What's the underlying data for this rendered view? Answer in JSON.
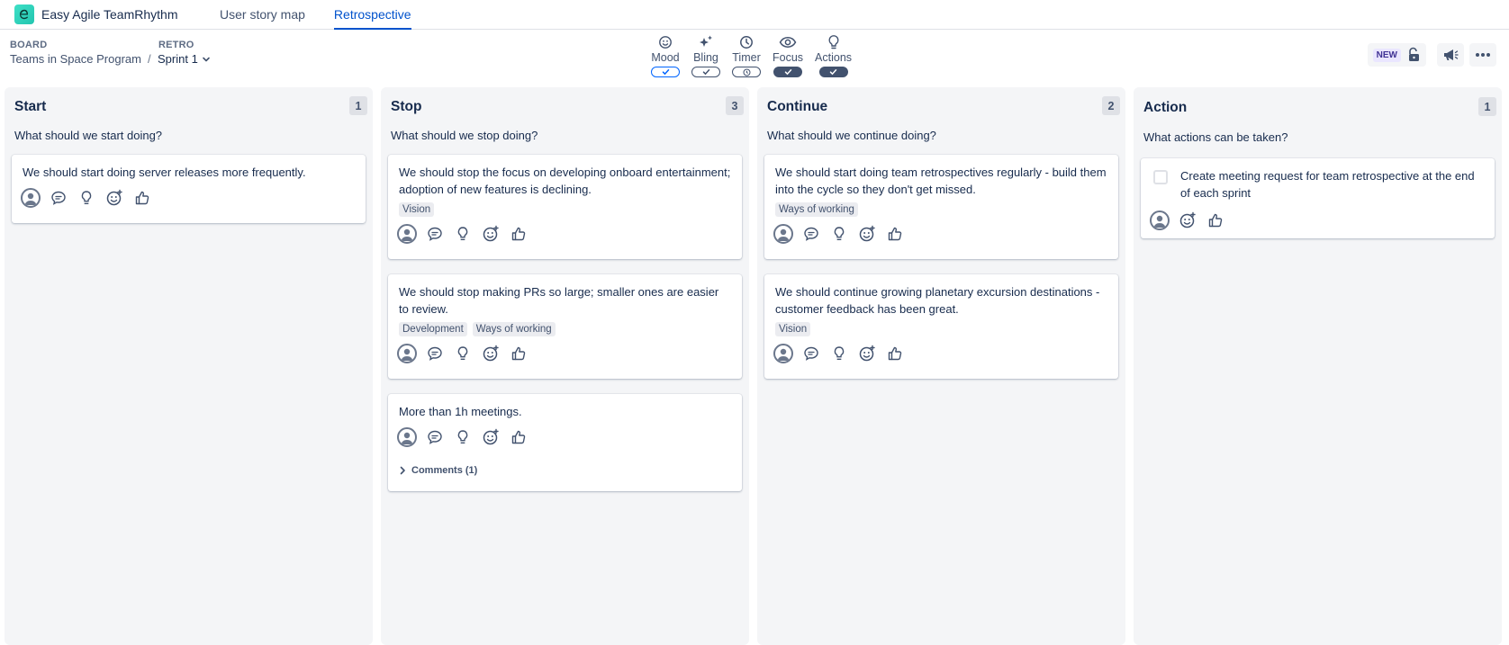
{
  "app": {
    "name": "Easy Agile TeamRhythm"
  },
  "tabs": [
    {
      "label": "User story map"
    },
    {
      "label": "Retrospective"
    }
  ],
  "breadcrumb": {
    "board_label": "BOARD",
    "board_value": "Teams in Space Program",
    "separator": "/",
    "retro_label": "RETRO",
    "retro_value": "Sprint 1"
  },
  "features": [
    {
      "label": "Mood",
      "icon": "smile-icon",
      "state": "on-outline"
    },
    {
      "label": "Bling",
      "icon": "sparkle-icon",
      "state": "on-gray"
    },
    {
      "label": "Timer",
      "icon": "clock-icon",
      "state": "timer"
    },
    {
      "label": "Focus",
      "icon": "eye-icon",
      "state": "on-filled"
    },
    {
      "label": "Actions",
      "icon": "lightbulb-icon",
      "state": "on-filled"
    }
  ],
  "header_actions": {
    "new_badge": "NEW"
  },
  "columns": [
    {
      "title": "Start",
      "count": "1",
      "prompt": "What should we start doing?",
      "cards": [
        {
          "text": "We should start doing server releases more frequently.",
          "labels": []
        }
      ]
    },
    {
      "title": "Stop",
      "count": "3",
      "prompt": "What should we stop doing?",
      "cards": [
        {
          "text": "We should stop the focus on developing onboard entertainment; adoption of new features is declining.",
          "labels": [
            "Vision"
          ]
        },
        {
          "text": "We should stop making PRs so large; smaller ones are easier to review.",
          "labels": [
            "Development",
            "Ways of working"
          ]
        },
        {
          "text": "More than 1h meetings.",
          "labels": [],
          "comments": "Comments (1)"
        }
      ]
    },
    {
      "title": "Continue",
      "count": "2",
      "prompt": "What should we continue doing?",
      "cards": [
        {
          "text": "We should start doing team retrospectives regularly - build them into the cycle so they don't get missed.",
          "labels": [
            "Ways of working"
          ]
        },
        {
          "text": "We should continue growing planetary excursion destinations - customer feedback has been great.",
          "labels": [
            "Vision"
          ]
        }
      ]
    },
    {
      "title": "Action",
      "count": "1",
      "prompt": "What actions can be taken?",
      "cards": [
        {
          "text": "Create meeting request for team retrospective at the end of each sprint",
          "labels": []
        }
      ]
    }
  ],
  "colors": {
    "primary": "#0052cc",
    "column_bg": "#f4f5f7",
    "text": "#172b4d",
    "muted": "#42526e"
  }
}
